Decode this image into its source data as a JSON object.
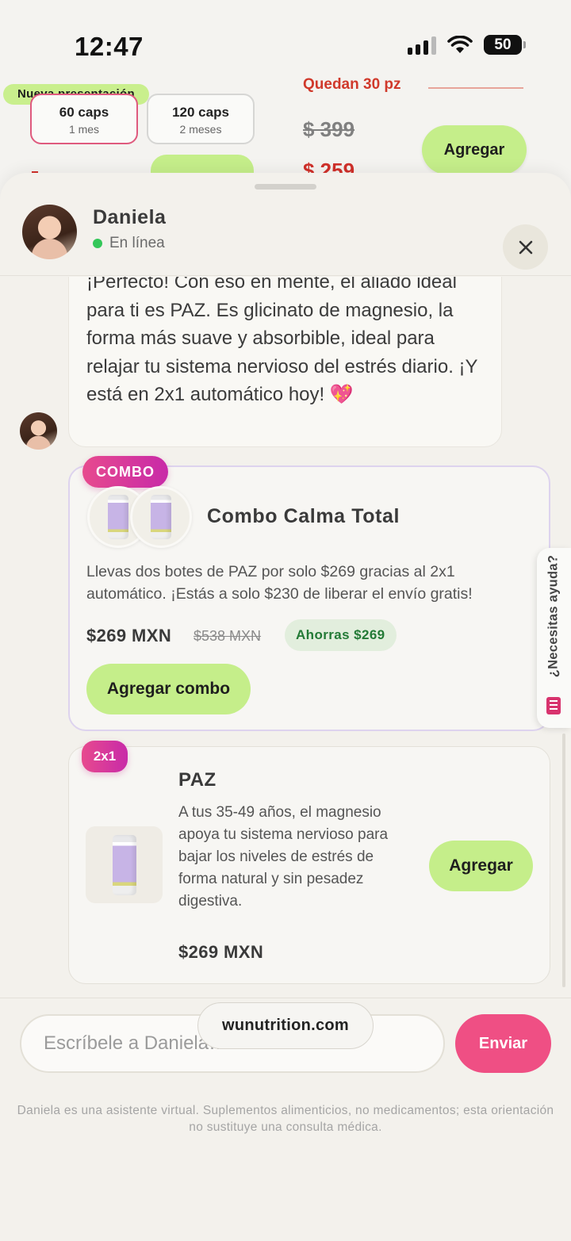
{
  "status_bar": {
    "time": "12:47",
    "battery": "50"
  },
  "background_product": {
    "badge": "Nueva presentación",
    "options": [
      {
        "title": "60 caps",
        "subtitle": "1 mes",
        "selected": true
      },
      {
        "title": "120 caps",
        "subtitle": "2 meses",
        "selected": false
      }
    ],
    "stock_text": "Quedan 30 pz",
    "old_price": "$ 399",
    "new_price": "$ 259",
    "add_label": "Agregar"
  },
  "chat": {
    "agent_name": "Daniela",
    "status": "En línea",
    "message": "¡Perfecto! Con eso en mente, el aliado ideal para ti es PAZ. Es glicinato de magnesio, la forma más suave y absorbible, ideal para relajar tu sistema nervioso del estrés diario. ¡Y está en 2x1 automático hoy! 💖",
    "combo": {
      "tag": "COMBO",
      "title": "Combo Calma Total",
      "description": "Llevas dos botes de PAZ por solo $269 gracias al 2x1 automático. ¡Estás a solo $230 de liberar el envío gratis!",
      "price": "$269 MXN",
      "old_price": "$538 MXN",
      "savings": "Ahorras $269",
      "button": "Agregar combo"
    },
    "product": {
      "tag": "2x1",
      "name": "PAZ",
      "description": "A tus 35-49 años, el magnesio apoya tu sistema nervioso para bajar los niveles de estrés de forma natural y sin pesadez digestiva.",
      "price": "$269 MXN",
      "button": "Agregar"
    },
    "input_placeholder": "Escríbele a Daniela…",
    "send_label": "Enviar",
    "disclaimer": "Daniela es una asistente virtual. Suplementos alimenticios, no medicamentos; esta orientación no sustituye una consulta médica."
  },
  "help_tab": {
    "label": "¿Necesitas ayuda?"
  },
  "footer": {
    "url": "wunutrition.com"
  },
  "colors": {
    "accent_green": "#c5ee8a",
    "accent_pink": "#ef4f84",
    "online": "#34c759",
    "price_red": "#d0302a"
  }
}
